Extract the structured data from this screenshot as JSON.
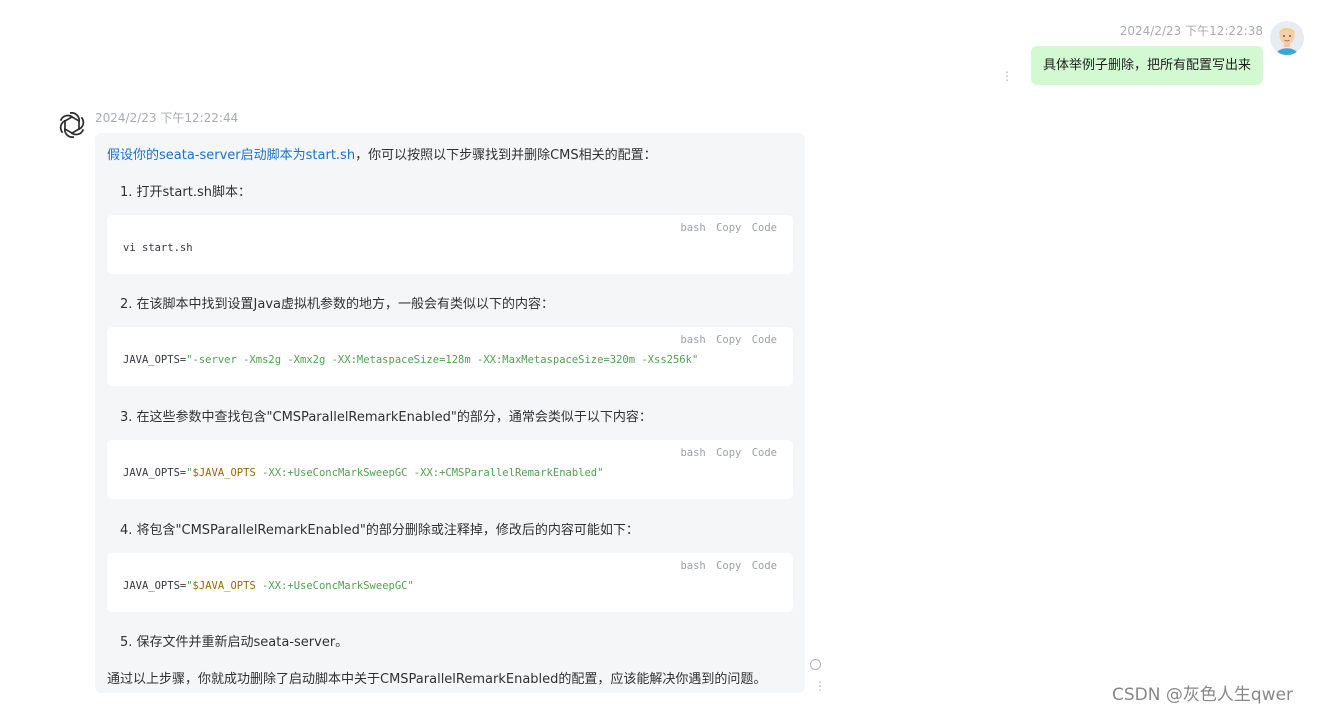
{
  "user_message": {
    "timestamp": "2024/2/23 下午12:22:38",
    "text": "具体举例子删除，把所有配置写出来",
    "menu_icon": "⋮"
  },
  "ai_message": {
    "timestamp": "2024/2/23 下午12:22:44",
    "intro_highlight": "假设你的seata-server启动脚本为start.sh",
    "intro_rest": "，你可以按照以下步骤找到并删除CMS相关的配置：",
    "steps": [
      "1. 打开start.sh脚本：",
      "2. 在该脚本中找到设置Java虚拟机参数的地方，一般会有类似以下的内容：",
      "3. 在这些参数中查找包含\"CMSParallelRemarkEnabled\"的部分，通常会类似于以下内容：",
      "4. 将包含\"CMSParallelRemarkEnabled\"的部分删除或注释掉，修改后的内容可能如下：",
      "5. 保存文件并重新启动seata-server。"
    ],
    "code_tools": {
      "lang": "bash",
      "copy": "Copy",
      "code": "Code"
    },
    "code_blocks": [
      {
        "plain": "vi start.sh"
      },
      {
        "prefix": "JAVA_OPTS=",
        "str": "\"-server -Xms2g -Xmx2g -XX:MetaspaceSize=128m -XX:MaxMetaspaceSize=320m -Xss256k\""
      },
      {
        "prefix": "JAVA_OPTS=",
        "str_open": "\"",
        "var": "$JAVA_OPTS",
        "str": " -XX:+UseConcMarkSweepGC -XX:+CMSParallelRemarkEnabled\""
      },
      {
        "prefix": "JAVA_OPTS=",
        "str_open": "\"",
        "var": "$JAVA_OPTS",
        "str": " -XX:+UseConcMarkSweepGC\""
      }
    ],
    "conclusion": "通过以上步骤，你就成功删除了启动脚本中关于CMSParallelRemarkEnabled的配置，应该能解决你遇到的问题。",
    "menu_icon": "⋮"
  },
  "watermark": "CSDN @灰色人生qwer",
  "colors": {
    "user_bubble": "#d2f9d1",
    "ai_bubble": "#f4f6f8",
    "link": "#1a73c8",
    "code_string": "#50a14f",
    "code_variable": "#986801"
  },
  "icons": {
    "user_avatar": "user-avatar-icon",
    "ai_avatar": "openai-logo-icon"
  }
}
